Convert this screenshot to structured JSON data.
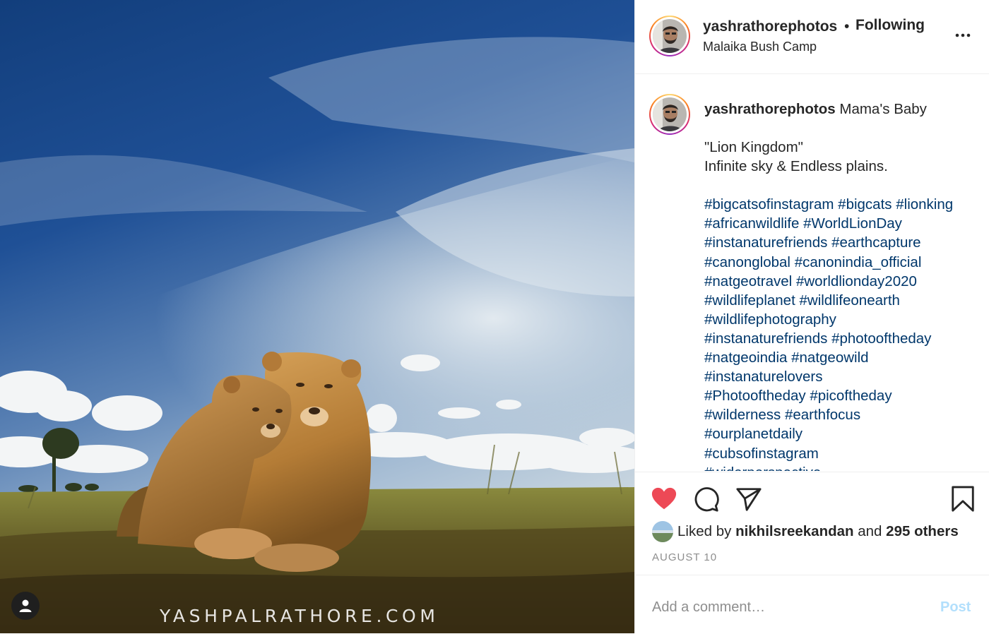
{
  "photo": {
    "watermark": "YASHPALRATHORE.COM",
    "alt": "Lioness with cub"
  },
  "header": {
    "username": "yashrathorephotos",
    "separator": "•",
    "follow_status": "Following",
    "location": "Malaika Bush Camp",
    "more_icon": "more-horizontal-icon"
  },
  "caption": {
    "username": "yashrathorephotos",
    "text": "Mama's Baby",
    "line1": "\"Lion Kingdom\"",
    "line2": "Infinite sky & Endless plains.",
    "hashtag_lines": [
      [
        "#bigcatsofinstagram",
        "#bigcats",
        "#lionking"
      ],
      [
        "#africanwildlife",
        "#WorldLionDay"
      ],
      [
        "#instanaturefriends",
        "#earthcapture"
      ],
      [
        "#canonglobal",
        "#canonindia_official"
      ],
      [
        "#natgeotravel",
        "#worldlionday2020"
      ],
      [
        "#wildlifeplanet",
        "#wildlifeonearth"
      ],
      [
        "#wildlifephotography"
      ],
      [
        "#instanaturefriends",
        "#photooftheday"
      ],
      [
        "#natgeoindia",
        "#natgeowild"
      ],
      [
        "#instanaturelovers"
      ],
      [
        "#Photooftheday",
        "#picoftheday"
      ],
      [
        "#wilderness",
        "#earthfocus"
      ],
      [
        "#ourplanetdaily"
      ],
      [
        "#cubsofinstagram"
      ],
      [
        "#widerperspective"
      ]
    ]
  },
  "actions": {
    "like_icon": "heart-filled-icon",
    "comment_icon": "comment-icon",
    "share_icon": "paper-plane-icon",
    "save_icon": "bookmark-icon",
    "like_color": "#ed4956"
  },
  "likes": {
    "prefix": "Liked by",
    "user": "nikhilsreekandan",
    "middle": "and",
    "others": "295 others"
  },
  "date": "AUGUST 10",
  "comment": {
    "placeholder": "Add a comment…",
    "post_label": "Post"
  }
}
